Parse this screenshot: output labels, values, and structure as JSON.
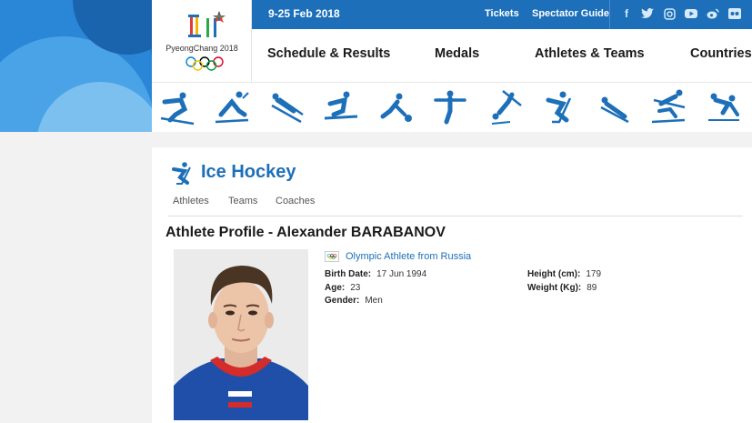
{
  "header": {
    "logo_text": "PyeongChang 2018",
    "dates": "9-25 Feb 2018",
    "tickets": "Tickets",
    "spectator_guide": "Spectator Guide",
    "social_icons": [
      "facebook-icon",
      "twitter-icon",
      "instagram-icon",
      "youtube-icon",
      "weibo-icon",
      "flickr-icon"
    ]
  },
  "nav": {
    "items": [
      "Schedule & Results",
      "Medals",
      "Athletes & Teams",
      "Countries"
    ]
  },
  "sports_bar": {
    "icons": [
      "alpine-skiing-icon",
      "cross-country-icon",
      "ski-jumping-icon",
      "snowboard-icon",
      "curling-icon",
      "figure-skating-icon",
      "freestyle-icon",
      "ice-hockey-icon",
      "luge-icon",
      "nordic-combined-icon",
      "short-track-icon"
    ]
  },
  "sport": {
    "title": "Ice Hockey",
    "tabs": [
      "Athletes",
      "Teams",
      "Coaches"
    ]
  },
  "profile": {
    "title": "Athlete Profile - Alexander BARABANOV",
    "noc": "Olympic Athlete from Russia",
    "birth_date_label": "Birth Date:",
    "birth_date": "17 Jun 1994",
    "age_label": "Age:",
    "age": "23",
    "gender_label": "Gender:",
    "gender": "Men",
    "height_label": "Height (cm):",
    "height": "179",
    "weight_label": "Weight (Kg):",
    "weight": "89"
  },
  "colors": {
    "brand_blue": "#1c6fb8",
    "topbar": "#1c6fb8"
  }
}
